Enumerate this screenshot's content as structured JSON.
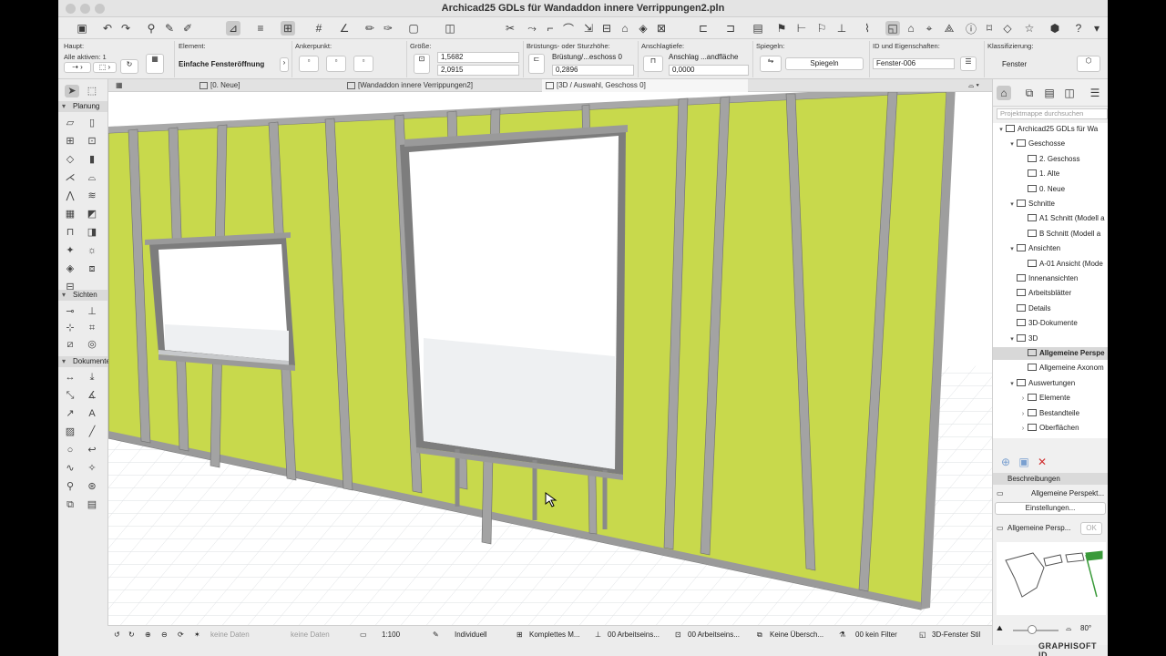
{
  "window": {
    "title": "Archicad25 GDLs für Wandaddon innere Verrippungen2.pln"
  },
  "infobox": {
    "main_label": "Haupt:",
    "layer_label": "Alle aktiven: 1",
    "element_label": "Element:",
    "element_value": "Einfache Fensteröffnung",
    "anchor_label": "Ankerpunkt:",
    "size_label": "Größe:",
    "width_value": "1,5682",
    "height_value": "2,0915",
    "sill_label": "Brüstungs- oder Sturzhöhe:",
    "sill_mode": "Brüstung/...eschoss 0",
    "sill_value": "0,2896",
    "reveal_label": "Anschlagtiefe:",
    "reveal_mode": "Anschlag ...andfläche",
    "reveal_value": "0,0000",
    "mirror_label": "Spiegeln:",
    "mirror_button": "Spiegeln",
    "id_label": "ID und Eigenschaften:",
    "id_value": "Fenster-006",
    "class_label": "Klassifizierung:",
    "class_value": "Fenster"
  },
  "tabs": [
    {
      "label": "[0. Neue]"
    },
    {
      "label": "[Wandaddon innere Verrippungen2]"
    },
    {
      "label": "[3D / Auswahl, Geschoss 0]"
    }
  ],
  "toolbox": {
    "sections": [
      "Planung",
      "Sichten",
      "Dokumente"
    ]
  },
  "statusbar": {
    "undo_data": "keine Daten",
    "redo_data": "keine Daten",
    "scale": "1:100",
    "pen_set": "Individuell",
    "model_view": "Komplettes M...",
    "layer_combo": "00 Arbeitseins...",
    "layer_combo2": "00 Arbeitseins...",
    "override": "Keine Übersch...",
    "filter": "00 kein Filter",
    "style": "3D-Fenster Stil"
  },
  "navigator": {
    "search_placeholder": "Projektmappe durchsuchen",
    "tree": [
      {
        "label": "Archicad25 GDLs für Wa",
        "level": 0,
        "toggle": "▾"
      },
      {
        "label": "Geschosse",
        "level": 1,
        "toggle": "▾"
      },
      {
        "label": "2. Geschoss",
        "level": 2,
        "toggle": ""
      },
      {
        "label": "1. Alte",
        "level": 2,
        "toggle": ""
      },
      {
        "label": "0. Neue",
        "level": 2,
        "toggle": ""
      },
      {
        "label": "Schnitte",
        "level": 1,
        "toggle": "▾"
      },
      {
        "label": "A1 Schnitt (Modell a",
        "level": 2,
        "toggle": ""
      },
      {
        "label": "B Schnitt (Modell a",
        "level": 2,
        "toggle": ""
      },
      {
        "label": "Ansichten",
        "level": 1,
        "toggle": "▾"
      },
      {
        "label": "A-01 Ansicht (Mode",
        "level": 2,
        "toggle": ""
      },
      {
        "label": "Innenansichten",
        "level": 1,
        "toggle": ""
      },
      {
        "label": "Arbeitsblätter",
        "level": 1,
        "toggle": ""
      },
      {
        "label": "Details",
        "level": 1,
        "toggle": ""
      },
      {
        "label": "3D-Dokumente",
        "level": 1,
        "toggle": ""
      },
      {
        "label": "3D",
        "level": 1,
        "toggle": "▾"
      },
      {
        "label": "Allgemeine Perspe",
        "level": 2,
        "toggle": "",
        "selected": true
      },
      {
        "label": "Allgemeine Axonom",
        "level": 2,
        "toggle": ""
      },
      {
        "label": "Auswertungen",
        "level": 1,
        "toggle": "▾"
      },
      {
        "label": "Elemente",
        "level": 2,
        "toggle": "›"
      },
      {
        "label": "Bestandteile",
        "level": 2,
        "toggle": "›"
      },
      {
        "label": "Oberflächen",
        "level": 2,
        "toggle": "›"
      }
    ],
    "descriptions_label": "Beschreibungen",
    "view_name": "Allgemeine Perspekt...",
    "settings_button": "Einstellungen...",
    "view_name2": "Allgemeine Persp...",
    "ok_button": "OK",
    "zoom_value": "80°"
  },
  "brand": "GRAPHISOFT ID",
  "colors": {
    "wall": "#c8d94c",
    "stud": "#9a9a9a"
  }
}
